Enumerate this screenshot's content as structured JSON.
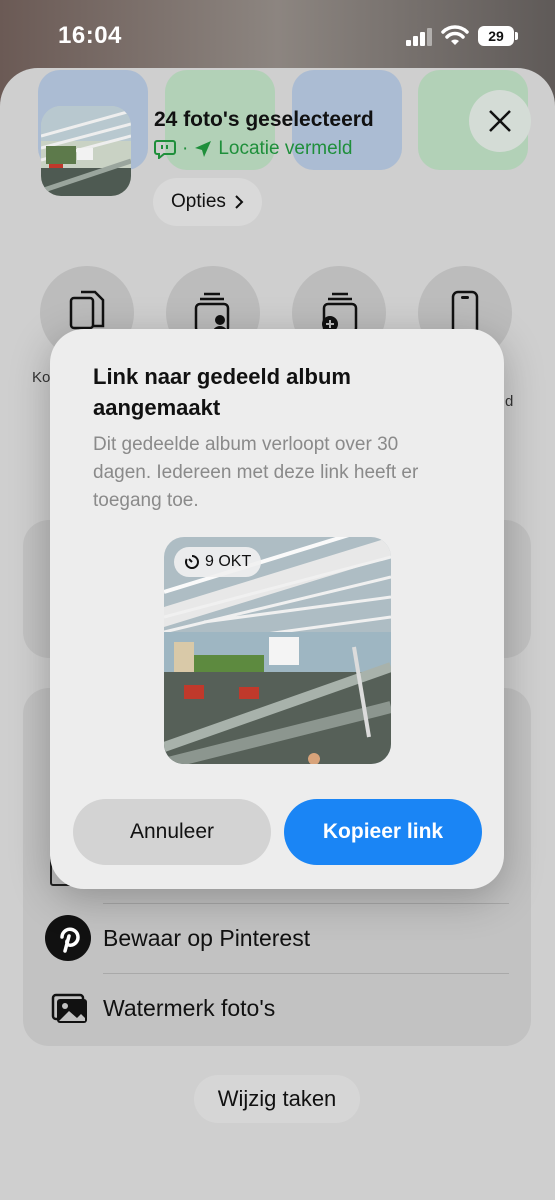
{
  "status_bar": {
    "time": "16:04",
    "battery": "29"
  },
  "share_sheet": {
    "title": "24 foto's geselecteerd",
    "subtitle_separator": "·",
    "location_label": "Locatie vermeld",
    "options_label": "Opties",
    "action_label_left_fragment": "Ko",
    "action_label_right_fragment": "d"
  },
  "rows": [
    {
      "label": "Bewaar op Pinterest",
      "icon": "pinterest-icon"
    },
    {
      "label": "Watermerk foto's",
      "icon": "photos-stack-icon"
    }
  ],
  "edit_actions_label": "Wijzig taken",
  "dialog": {
    "title": "Link naar gedeeld album aangemaakt",
    "message": "Dit gedeelde album verloopt over 30 dagen. Iedereen met deze link heeft er toegang toe.",
    "expiry_badge": "9 OKT",
    "cancel_label": "Annuleer",
    "copy_label": "Kopieer link"
  },
  "colors": {
    "accent": "#1a85f5",
    "location_green": "#1f8f3b"
  }
}
